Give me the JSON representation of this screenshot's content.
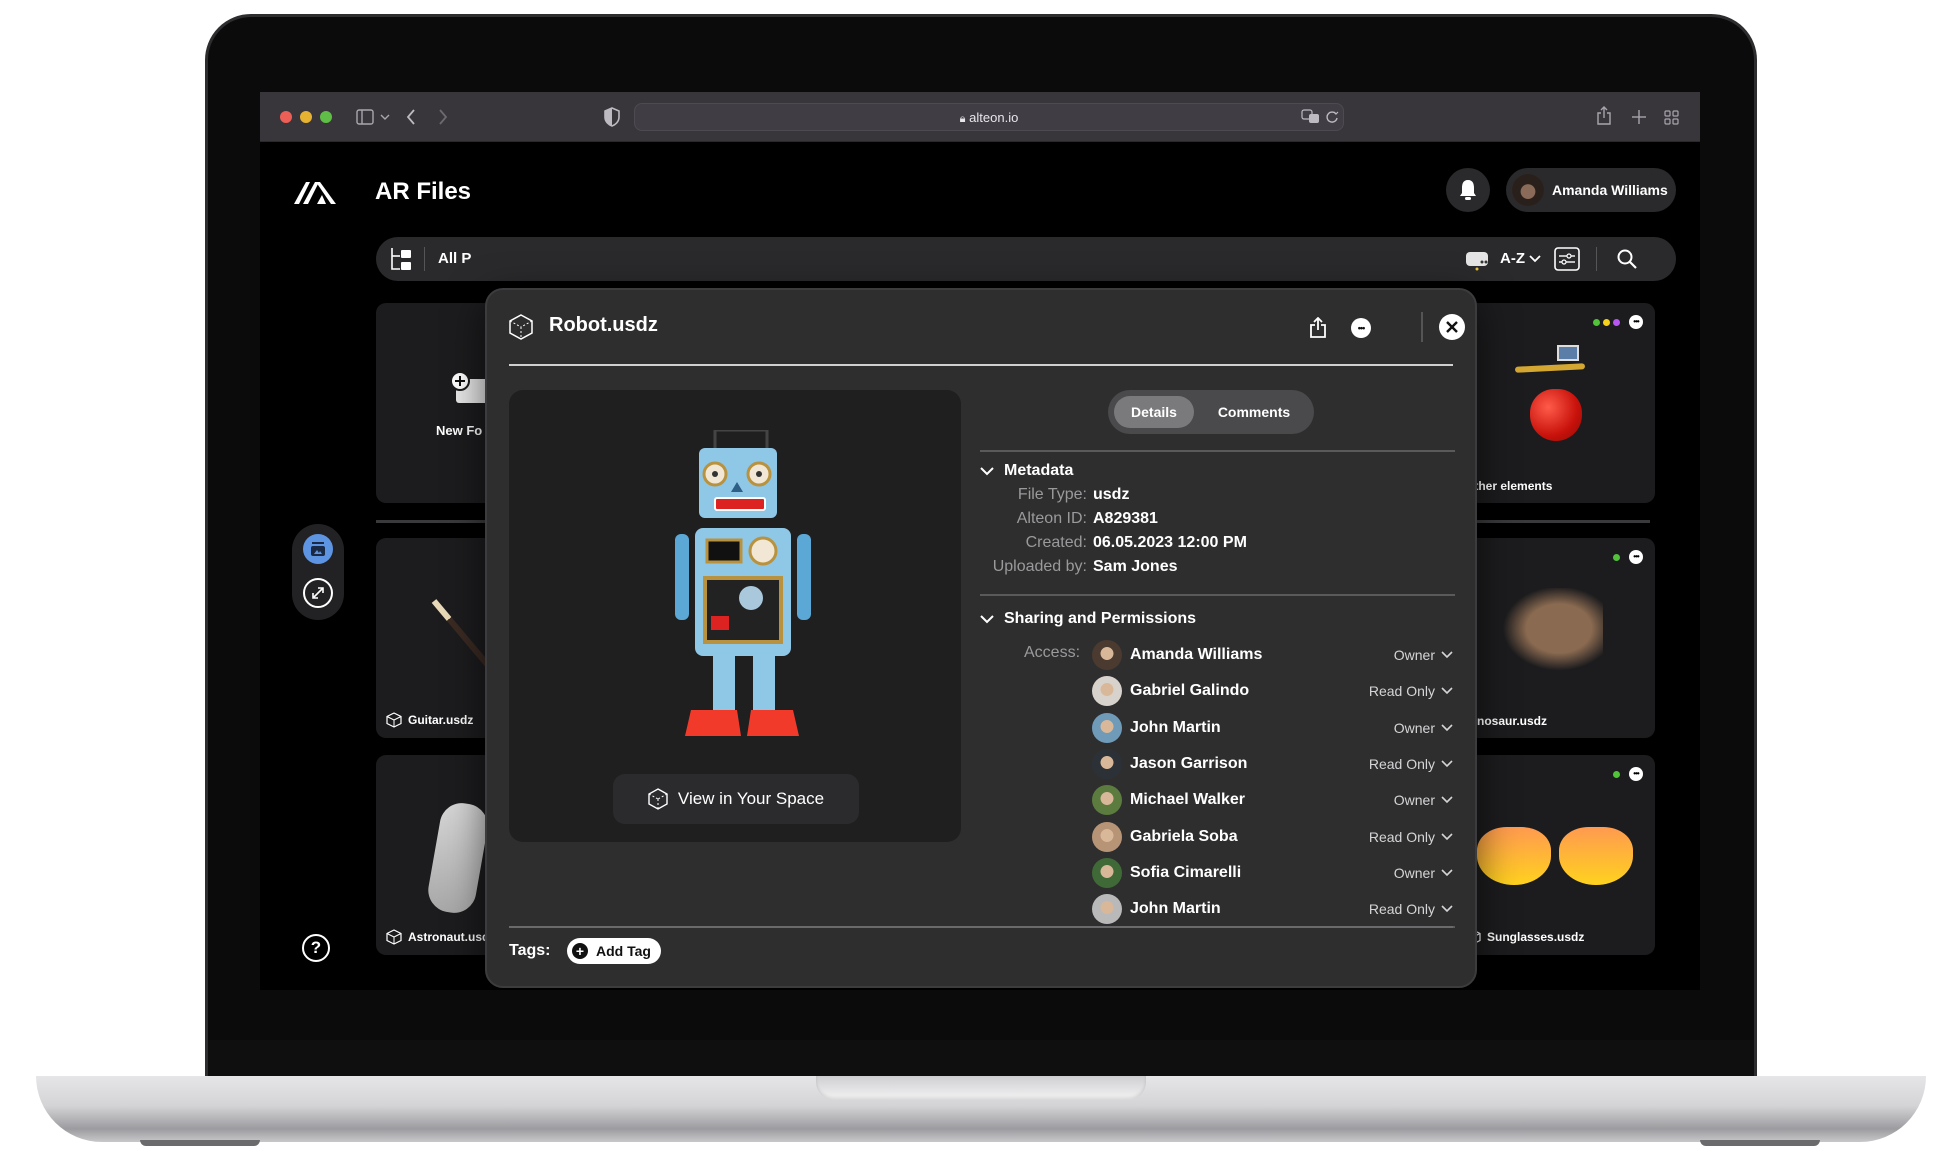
{
  "browser": {
    "url": "alteon.io",
    "traffic_lights": {
      "close": "#ec5f57",
      "minimize": "#e5b232",
      "zoom": "#5fbe46"
    },
    "icons": [
      "sidebar-icon",
      "chevron-down-icon",
      "back-icon",
      "forward-icon",
      "shield-icon",
      "lock-icon",
      "translate-icon",
      "reload-icon",
      "share-icon",
      "new-tab-icon",
      "tab-overview-icon"
    ]
  },
  "app": {
    "title": "AR Files",
    "user": {
      "name": "Amanda Williams"
    },
    "filterbar": {
      "scope_label": "All P",
      "sort_label": "A-Z"
    },
    "help_label": "?"
  },
  "cards": {
    "new_folder": {
      "label": "New Fo"
    },
    "other_elements": {
      "label": "Other elements",
      "status_colors": [
        "#52c23a",
        "#f2d21f",
        "#b658f0"
      ]
    },
    "guitar": {
      "label": "Guitar.usdz"
    },
    "dinosaur": {
      "label": "Dinosaur.usdz",
      "status_colors": [
        "#52c23a"
      ]
    },
    "astronaut": {
      "label": "Astronaut.usdz"
    },
    "sunglasses": {
      "label": "Sunglasses.usdz",
      "status_colors": [
        "#52c23a"
      ]
    }
  },
  "modal": {
    "title": "Robot.usdz",
    "view_in_space_label": "View in Your Space",
    "tabs": [
      {
        "label": "Details",
        "active": true
      },
      {
        "label": "Comments",
        "active": false
      }
    ],
    "metadata": {
      "section_title": "Metadata",
      "rows": [
        {
          "key": "File Type:",
          "value": "usdz"
        },
        {
          "key": "Alteon ID:",
          "value": "A829381"
        },
        {
          "key": "Created:",
          "value": "06.05.2023 12:00 PM"
        },
        {
          "key": "Uploaded by:",
          "value": "Sam Jones"
        }
      ]
    },
    "sharing": {
      "section_title": "Sharing and Permissions",
      "access_label": "Access:",
      "people": [
        {
          "name": "Amanda Williams",
          "permission": "Owner",
          "avatar_color": "#4a3a30"
        },
        {
          "name": "Gabriel Galindo",
          "permission": "Read Only",
          "avatar_color": "#d8d2cc"
        },
        {
          "name": "John Martin",
          "permission": "Owner",
          "avatar_color": "#6f9bb8"
        },
        {
          "name": "Jason Garrison",
          "permission": "Read Only",
          "avatar_color": "#2c3138"
        },
        {
          "name": "Michael Walker",
          "permission": "Owner",
          "avatar_color": "#5c7b3e"
        },
        {
          "name": "Gabriela Soba",
          "permission": "Read Only",
          "avatar_color": "#b89477"
        },
        {
          "name": "Sofia Cimarelli",
          "permission": "Owner",
          "avatar_color": "#3f6a37"
        },
        {
          "name": "John Martin",
          "permission": "Read Only",
          "avatar_color": "#b9b9b9"
        }
      ]
    },
    "tags": {
      "label": "Tags:",
      "add_label": "Add Tag"
    }
  }
}
